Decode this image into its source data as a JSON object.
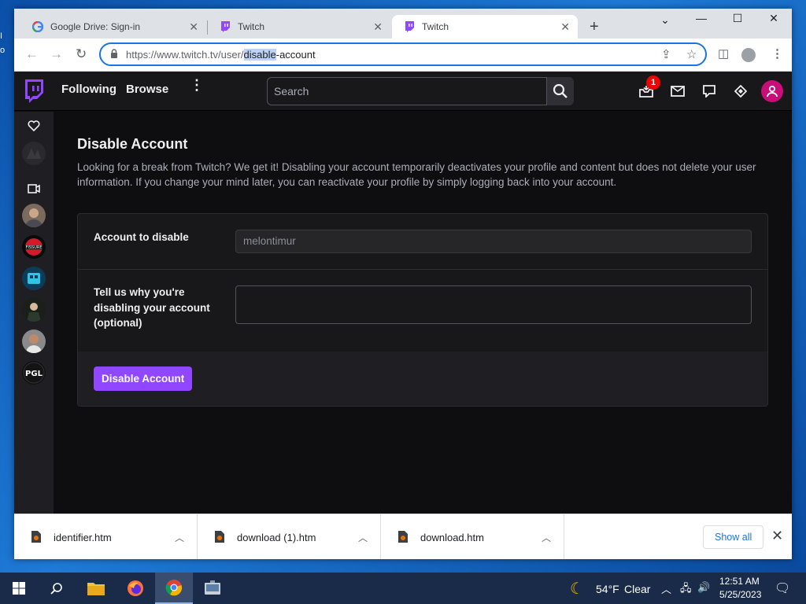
{
  "desktop": {
    "frag_top": "I",
    "frag_bottom": "o"
  },
  "browser": {
    "tabs": [
      {
        "title": "Google Drive: Sign-in",
        "icon": "google-icon"
      },
      {
        "title": "Twitch",
        "icon": "twitch-icon"
      },
      {
        "title": "Twitch",
        "icon": "twitch-icon",
        "active": true
      }
    ],
    "url": {
      "prefix": "https://www.twitch.tv/user/",
      "selected": "disable",
      "suffix": "-account"
    }
  },
  "twitch": {
    "nav": {
      "following": "Following",
      "browse": "Browse",
      "search_placeholder": "Search",
      "notification_count": "1"
    },
    "page": {
      "title": "Disable Account",
      "description": "Looking for a break from Twitch? We get it! Disabling your account temporarily deactivates your profile and content but does not delete your user information. If you change your mind later, you can reactivate your profile by simply logging back into your account.",
      "account_label": "Account to disable",
      "account_value": "melontimur",
      "reason_label": "Tell us why you're disabling your account (optional)",
      "reason_value": "",
      "submit_label": "Disable Account"
    },
    "colors": {
      "brand": "#9147ff",
      "bg": "#0e0e10",
      "panel": "#18181b"
    }
  },
  "downloads": {
    "items": [
      {
        "name": "identifier.htm"
      },
      {
        "name": "download (1).htm"
      },
      {
        "name": "download.htm"
      }
    ],
    "show_all": "Show all"
  },
  "taskbar": {
    "weather": {
      "temp": "54°F",
      "condition": "Clear"
    },
    "time": "12:51 AM",
    "date": "5/25/2023"
  }
}
